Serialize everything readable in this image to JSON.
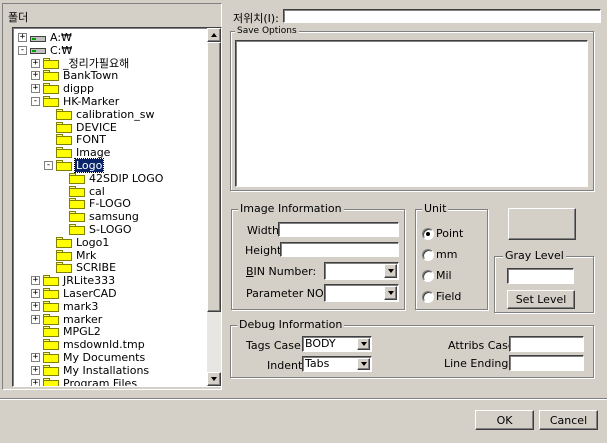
{
  "folder_panel": {
    "header": "폴더",
    "tree": [
      {
        "label": "A:₩",
        "kind": "drive",
        "expander": "+"
      },
      {
        "label": "C:₩",
        "kind": "drive",
        "expander": "-"
      },
      {
        "label": "_정리가필요해",
        "kind": "folder",
        "expander": "+"
      },
      {
        "label": "BankTown",
        "kind": "folder",
        "expander": "+"
      },
      {
        "label": "digpp",
        "kind": "folder",
        "expander": "+"
      },
      {
        "label": "HK-Marker",
        "kind": "folder",
        "expander": "-"
      },
      {
        "label": "calibration_sw",
        "kind": "folder",
        "expander": ""
      },
      {
        "label": "DEVICE",
        "kind": "folder",
        "expander": ""
      },
      {
        "label": "FONT",
        "kind": "folder",
        "expander": ""
      },
      {
        "label": "Image",
        "kind": "folder",
        "expander": ""
      },
      {
        "label": "Logo",
        "kind": "folder",
        "expander": "-",
        "selected": true
      },
      {
        "label": "42SDIP LOGO",
        "kind": "folder",
        "expander": ""
      },
      {
        "label": "cal",
        "kind": "folder",
        "expander": ""
      },
      {
        "label": "F-LOGO",
        "kind": "folder",
        "expander": ""
      },
      {
        "label": "samsung",
        "kind": "folder",
        "expander": ""
      },
      {
        "label": "S-LOGO",
        "kind": "folder",
        "expander": ""
      },
      {
        "label": "Logo1",
        "kind": "folder",
        "expander": ""
      },
      {
        "label": "Mrk",
        "kind": "folder",
        "expander": ""
      },
      {
        "label": "SCRIBE",
        "kind": "folder",
        "expander": ""
      },
      {
        "label": "JRLite333",
        "kind": "folder",
        "expander": "+"
      },
      {
        "label": "LaserCAD",
        "kind": "folder",
        "expander": "+"
      },
      {
        "label": "mark3",
        "kind": "folder",
        "expander": "+"
      },
      {
        "label": "marker",
        "kind": "folder",
        "expander": "+"
      },
      {
        "label": "MPGL2",
        "kind": "folder",
        "expander": ""
      },
      {
        "label": "msdownld.tmp",
        "kind": "folder",
        "expander": ""
      },
      {
        "label": "My Documents",
        "kind": "folder",
        "expander": "+"
      },
      {
        "label": "My Installations",
        "kind": "folder",
        "expander": "+"
      },
      {
        "label": "Program Files",
        "kind": "folder",
        "expander": "+"
      }
    ]
  },
  "location": {
    "label": "저위치(I):",
    "value": ""
  },
  "save_options": {
    "legend": "Save Options"
  },
  "image_info": {
    "legend": "Image Information",
    "width_label": "Width:",
    "width_value": "",
    "height_label": "Height:",
    "height_value": "",
    "bin_label": "BIN Number:",
    "bin_value": "",
    "param_label": "Parameter NO.:",
    "param_value": ""
  },
  "unit": {
    "legend": "Unit",
    "options": [
      "Point",
      "mm",
      "Mil",
      "Field"
    ],
    "selected": "Point"
  },
  "preview_button": {
    "label": ""
  },
  "gray_level": {
    "legend": "Gray Level",
    "value": "",
    "set_label": "Set Level"
  },
  "debug": {
    "legend": "Debug Information",
    "tags_case_label": "Tags Case:",
    "tags_case_value": "BODY",
    "indent_label": "Indent:",
    "indent_value": "Tabs",
    "attribs_case_label": "Attribs Case:",
    "attribs_case_value": "",
    "line_endings_label": "Line Endings:",
    "line_endings_value": ""
  },
  "buttons": {
    "ok": "OK",
    "cancel": "Cancel"
  }
}
